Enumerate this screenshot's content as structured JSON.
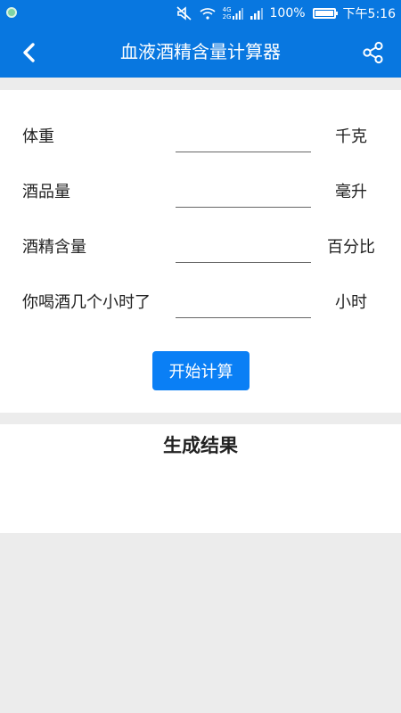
{
  "status_bar": {
    "battery": "100%",
    "time": "下午5:16",
    "network_labels": [
      "4G",
      "2G"
    ]
  },
  "app_bar": {
    "title": "血液酒精含量计算器"
  },
  "form": {
    "rows": [
      {
        "label": "体重",
        "value": "",
        "unit": "千克"
      },
      {
        "label": "酒品量",
        "value": "",
        "unit": "毫升"
      },
      {
        "label": "酒精含量",
        "value": "",
        "unit": "百分比"
      },
      {
        "label": "你喝酒几个小时了",
        "value": "",
        "unit": "小时"
      }
    ],
    "calculate_label": "开始计算"
  },
  "result": {
    "title": "生成结果"
  },
  "colors": {
    "primary": "#0877e0",
    "button": "#0a7ff5",
    "background": "#ececec"
  }
}
